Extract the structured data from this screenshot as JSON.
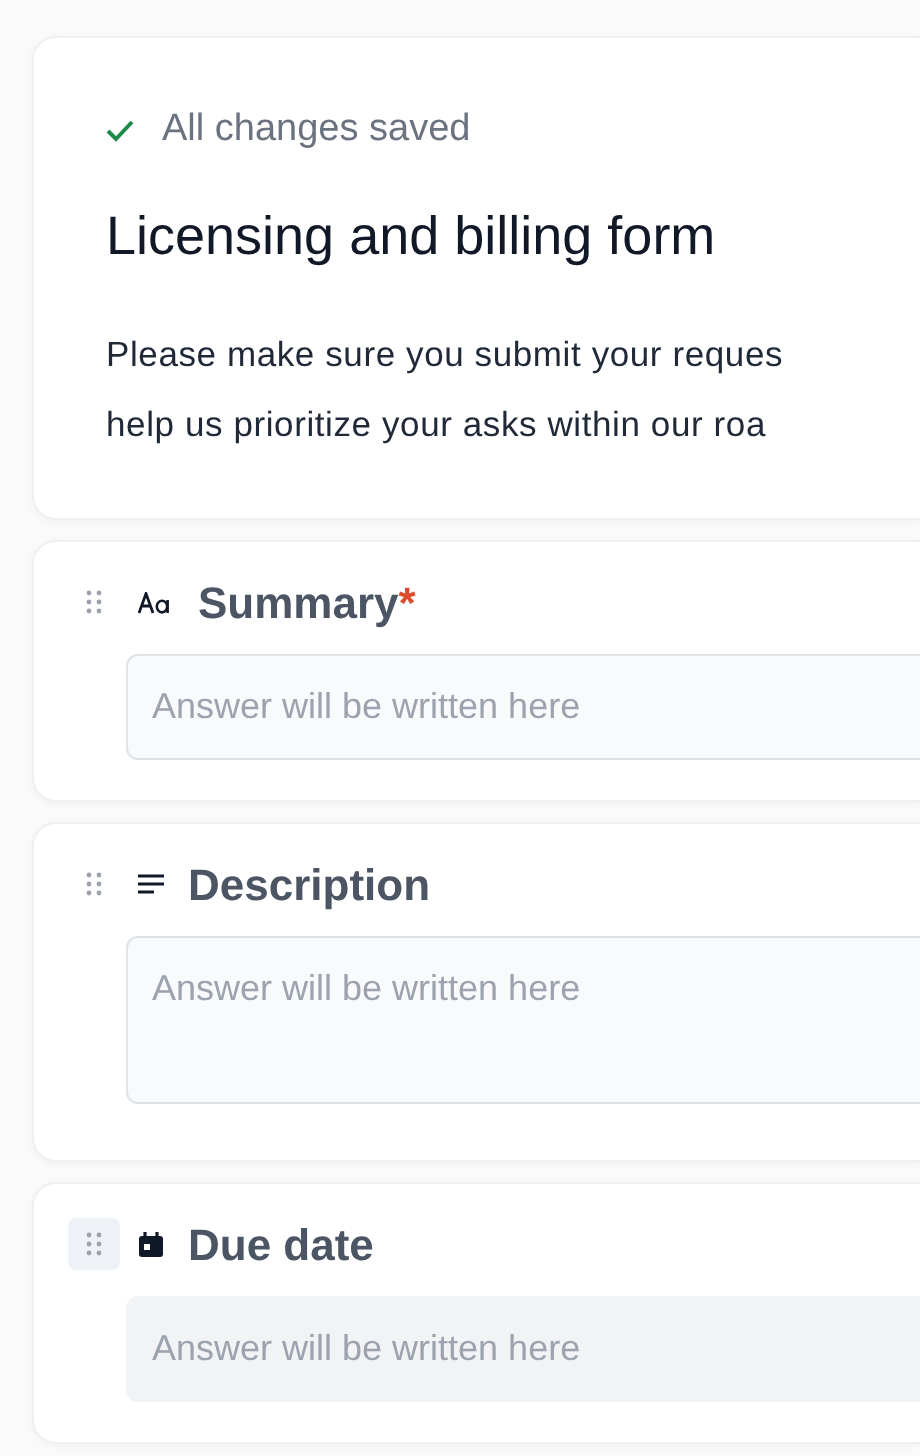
{
  "save_status": {
    "text": "All changes saved",
    "saved": true
  },
  "form": {
    "title": "Licensing and billing form",
    "description_lines": [
      "Please make sure you submit your reques",
      "help us prioritize your asks within our roa"
    ]
  },
  "questions": [
    {
      "kind": "text",
      "label": "Summary",
      "required_mark": "*",
      "placeholder": "Answer will be written here",
      "handle_active": false
    },
    {
      "kind": "paragraph",
      "label": "Description",
      "placeholder": "Answer will be written here",
      "handle_active": false
    },
    {
      "kind": "date",
      "label": "Due date",
      "placeholder": "Answer will be written here",
      "handle_active": true
    }
  ]
}
